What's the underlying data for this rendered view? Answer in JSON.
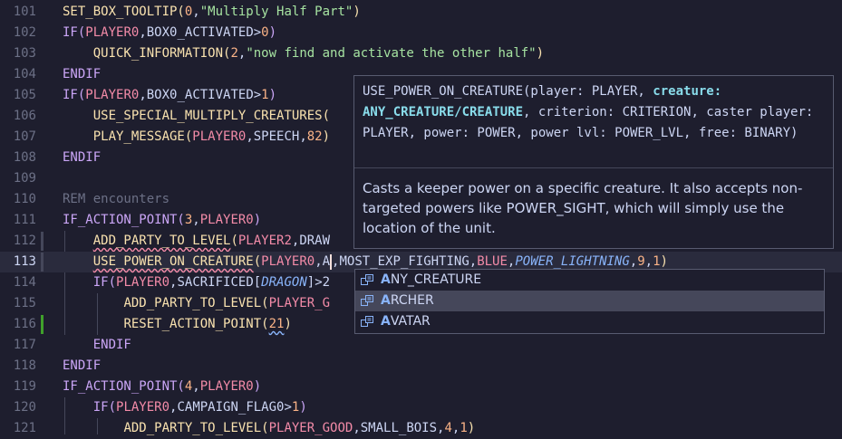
{
  "editor": {
    "lines": [
      {
        "num": "101",
        "segments": [
          {
            "t": "SET_BOX_TOOLTIP(",
            "c": "k"
          },
          {
            "t": "0",
            "c": "n"
          },
          {
            "t": ",",
            "c": "d"
          },
          {
            "t": "\"Multiply Half Part\"",
            "c": "s"
          },
          {
            "t": ")",
            "c": "k"
          }
        ]
      },
      {
        "num": "102",
        "segments": [
          {
            "t": "IF(",
            "c": "m"
          },
          {
            "t": "PLAYER0",
            "c": "e"
          },
          {
            "t": ",BOX0_ACTIVATED>",
            "c": "d"
          },
          {
            "t": "0",
            "c": "n"
          },
          {
            "t": ")",
            "c": "m"
          }
        ]
      },
      {
        "num": "103",
        "indent": "    ",
        "segments": [
          {
            "t": "QUICK_INFORMATION(",
            "c": "k"
          },
          {
            "t": "2",
            "c": "n"
          },
          {
            "t": ",",
            "c": "d"
          },
          {
            "t": "\"now find and activate the other half\"",
            "c": "s"
          },
          {
            "t": ")",
            "c": "k"
          }
        ]
      },
      {
        "num": "104",
        "segments": [
          {
            "t": "ENDIF",
            "c": "m"
          }
        ]
      },
      {
        "num": "105",
        "segments": [
          {
            "t": "IF(",
            "c": "m"
          },
          {
            "t": "PLAYER0",
            "c": "e"
          },
          {
            "t": ",BOX0_ACTIVATED>",
            "c": "d"
          },
          {
            "t": "1",
            "c": "n"
          },
          {
            "t": ")",
            "c": "m"
          }
        ]
      },
      {
        "num": "106",
        "indent": "    ",
        "segments": [
          {
            "t": "USE_SPECIAL_MULTIPLY_CREATURES(",
            "c": "k"
          }
        ]
      },
      {
        "num": "107",
        "indent": "    ",
        "segments": [
          {
            "t": "PLAY_MESSAGE(",
            "c": "k"
          },
          {
            "t": "PLAYER0",
            "c": "e"
          },
          {
            "t": ",SPEECH,",
            "c": "d"
          },
          {
            "t": "82",
            "c": "n"
          },
          {
            "t": ")",
            "c": "k"
          }
        ]
      },
      {
        "num": "108",
        "segments": [
          {
            "t": "ENDIF",
            "c": "m"
          }
        ]
      },
      {
        "num": "109",
        "segments": []
      },
      {
        "num": "110",
        "segments": [
          {
            "t": "REM encounters",
            "c": "c"
          }
        ]
      },
      {
        "num": "111",
        "segments": [
          {
            "t": "IF_ACTION_POINT(",
            "c": "m"
          },
          {
            "t": "3",
            "c": "n"
          },
          {
            "t": ",",
            "c": "d"
          },
          {
            "t": "PLAYER0",
            "c": "e"
          },
          {
            "t": ")",
            "c": "m"
          }
        ]
      },
      {
        "num": "112",
        "indent": "    ",
        "segments": [
          {
            "t": "ADD_PARTY_TO_LEVEL",
            "c": "k sq"
          },
          {
            "t": "(",
            "c": "k"
          },
          {
            "t": "PLAYER2",
            "c": "e"
          },
          {
            "t": ",DRAW",
            "c": "d"
          }
        ]
      },
      {
        "num": "113",
        "indent": "    ",
        "current": true,
        "segments": [
          {
            "t": "USE_POWER_ON_CREATURE",
            "c": "k sq"
          },
          {
            "t": "(",
            "c": "k"
          },
          {
            "t": "PLAYER0",
            "c": "e"
          },
          {
            "t": ",A",
            "c": "d"
          },
          {
            "t": "CURSOR",
            "c": "cur"
          },
          {
            "t": ",MOST_EXP_FIGHTING,",
            "c": "d"
          },
          {
            "t": "BLUE",
            "c": "e"
          },
          {
            "t": ",",
            "c": "d"
          },
          {
            "t": "POWER_LIGHTNING",
            "c": "i"
          },
          {
            "t": ",",
            "c": "d"
          },
          {
            "t": "9",
            "c": "n"
          },
          {
            "t": ",",
            "c": "d"
          },
          {
            "t": "1",
            "c": "n"
          },
          {
            "t": ")",
            "c": "k"
          }
        ]
      },
      {
        "num": "114",
        "indent": "    ",
        "segments": [
          {
            "t": "IF(",
            "c": "m"
          },
          {
            "t": "PLAYER0",
            "c": "e"
          },
          {
            "t": ",SACRIFICED[",
            "c": "d"
          },
          {
            "t": "DRAGON",
            "c": "i"
          },
          {
            "t": "]>2",
            "c": "d"
          }
        ]
      },
      {
        "num": "115",
        "indent": "        ",
        "segments": [
          {
            "t": "ADD_PARTY_TO_LEVEL(",
            "c": "k"
          },
          {
            "t": "PLAYER_G",
            "c": "e"
          }
        ]
      },
      {
        "num": "116",
        "indent": "        ",
        "segments": [
          {
            "t": "RESET_ACTION_POINT(",
            "c": "k"
          },
          {
            "t": "21",
            "c": "n sq2"
          },
          {
            "t": ")",
            "c": "k"
          }
        ]
      },
      {
        "num": "117",
        "indent": "    ",
        "segments": [
          {
            "t": "ENDIF",
            "c": "m"
          }
        ]
      },
      {
        "num": "118",
        "segments": [
          {
            "t": "ENDIF",
            "c": "m"
          }
        ]
      },
      {
        "num": "119",
        "segments": [
          {
            "t": "IF_ACTION_POINT(",
            "c": "m"
          },
          {
            "t": "4",
            "c": "n"
          },
          {
            "t": ",",
            "c": "d"
          },
          {
            "t": "PLAYER0",
            "c": "e"
          },
          {
            "t": ")",
            "c": "m"
          }
        ]
      },
      {
        "num": "120",
        "indent": "    ",
        "segments": [
          {
            "t": "IF(",
            "c": "m"
          },
          {
            "t": "PLAYER0",
            "c": "e"
          },
          {
            "t": ",CAMPAIGN_FLAG0>",
            "c": "d"
          },
          {
            "t": "1",
            "c": "n"
          },
          {
            "t": ")",
            "c": "m"
          }
        ]
      },
      {
        "num": "121",
        "indent": "        ",
        "segments": [
          {
            "t": "ADD_PARTY_TO_LEVEL(",
            "c": "k"
          },
          {
            "t": "PLAYER_GOOD",
            "c": "e"
          },
          {
            "t": ",SMALL_BOIS,",
            "c": "d"
          },
          {
            "t": "4",
            "c": "n"
          },
          {
            "t": ",",
            "c": "d"
          },
          {
            "t": "1",
            "c": "n"
          },
          {
            "t": ")",
            "c": "k"
          }
        ]
      }
    ],
    "gutter_marks": {
      "112": "#45475a",
      "113": "#45475a",
      "116": "#40a02b"
    }
  },
  "hover": {
    "signature_before": "USE_POWER_ON_CREATURE(player: PLAYER, ",
    "signature_active": "creature: ANY_CREATURE/CREATURE",
    "signature_after": ", criterion: CRITERION, caster player: PLAYER, power: POWER, power lvl: POWER_LVL, free: BINARY)",
    "documentation": "Casts a keeper power on a specific creature. It also accepts non-targeted powers like POWER_SIGHT, which will simply use the location of the unit."
  },
  "suggest": {
    "items": [
      {
        "match": "A",
        "rest": "NY_CREATURE",
        "selected": false
      },
      {
        "match": "A",
        "rest": "RCHER",
        "selected": true
      },
      {
        "match": "A",
        "rest": "VATAR",
        "selected": false
      }
    ],
    "icon": "enum-member-icon"
  }
}
